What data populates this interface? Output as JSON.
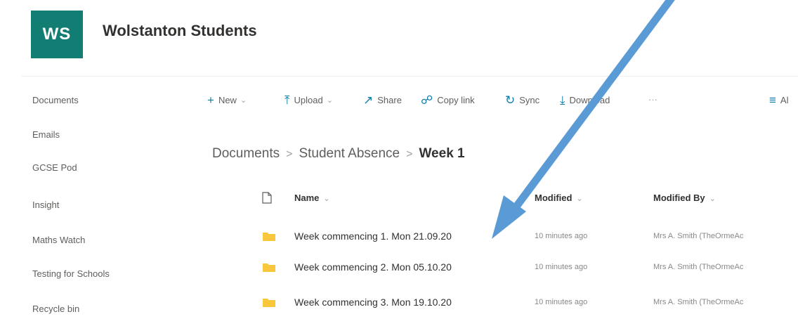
{
  "site": {
    "logo_text": "WS",
    "title": "Wolstanton Students",
    "accent": "#117d73"
  },
  "nav": {
    "items": [
      "Documents",
      "Emails",
      "GCSE Pod",
      "Insight",
      "Maths Watch",
      "Testing for Schools",
      "Recycle bin"
    ]
  },
  "commands": {
    "new": "New",
    "upload": "Upload",
    "share": "Share",
    "copy_link": "Copy link",
    "sync": "Sync",
    "download": "Download",
    "more": "···",
    "all": "Al"
  },
  "breadcrumb": {
    "root": "Documents",
    "parent": "Student Absence",
    "current": "Week 1"
  },
  "columns": {
    "name": "Name",
    "modified": "Modified",
    "modified_by": "Modified By"
  },
  "rows": [
    {
      "name": "Week commencing 1. Mon 21.09.20",
      "modified": "10 minutes ago",
      "modified_by": "Mrs A. Smith (TheOrmeAc"
    },
    {
      "name": "Week commencing 2. Mon 05.10.20",
      "modified": "10 minutes ago",
      "modified_by": "Mrs A. Smith (TheOrmeAc"
    },
    {
      "name": "Week commencing 3. Mon 19.10.20",
      "modified": "10 minutes ago",
      "modified_by": "Mrs A. Smith (TheOrmeAc"
    }
  ],
  "annotation": {
    "arrow_color": "#5b9bd5"
  }
}
